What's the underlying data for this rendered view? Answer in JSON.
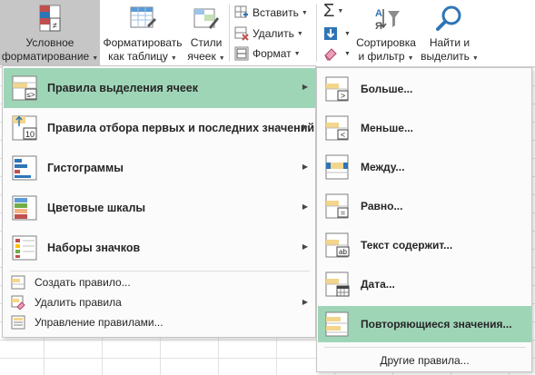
{
  "ribbon": {
    "conditional_formatting": {
      "line1": "Условное",
      "line2": "форматирование"
    },
    "format_as_table": {
      "line1": "Форматировать",
      "line2": "как таблицу"
    },
    "cell_styles": {
      "line1": "Стили",
      "line2": "ячеек"
    },
    "insert": "Вставить",
    "delete": "Удалить",
    "format": "Формат",
    "sort_filter": {
      "line1": "Сортировка",
      "line2": "и фильтр"
    },
    "find_select": {
      "line1": "Найти и",
      "line2": "выделить"
    }
  },
  "menu": {
    "items": [
      {
        "label": "Правила выделения ячеек",
        "highlighted": true
      },
      {
        "label": "Правила отбора первых и последних значений"
      },
      {
        "label": "Гистограммы"
      },
      {
        "label": "Цветовые шкалы"
      },
      {
        "label": "Наборы значков"
      }
    ],
    "small_items": [
      {
        "label": "Создать правило..."
      },
      {
        "label": "Удалить правила"
      },
      {
        "label": "Управление правилами..."
      }
    ]
  },
  "submenu": {
    "items": [
      {
        "label": "Больше...",
        "glyph": ">"
      },
      {
        "label": "Меньше...",
        "glyph": "<"
      },
      {
        "label": "Между..."
      },
      {
        "label": "Равно...",
        "glyph": "="
      },
      {
        "label": "Текст содержит...",
        "glyph": "ab"
      },
      {
        "label": "Дата..."
      },
      {
        "label": "Повторяющиеся значения...",
        "highlighted": true
      }
    ],
    "footer": "Другие правила..."
  },
  "colors": {
    "highlight": "#9fd5b7",
    "ribbon_active": "#c6c6c6",
    "icon_cell_yellow": "#f3d58b",
    "icon_blue": "#2e75b6",
    "icon_red": "#c0504d"
  }
}
